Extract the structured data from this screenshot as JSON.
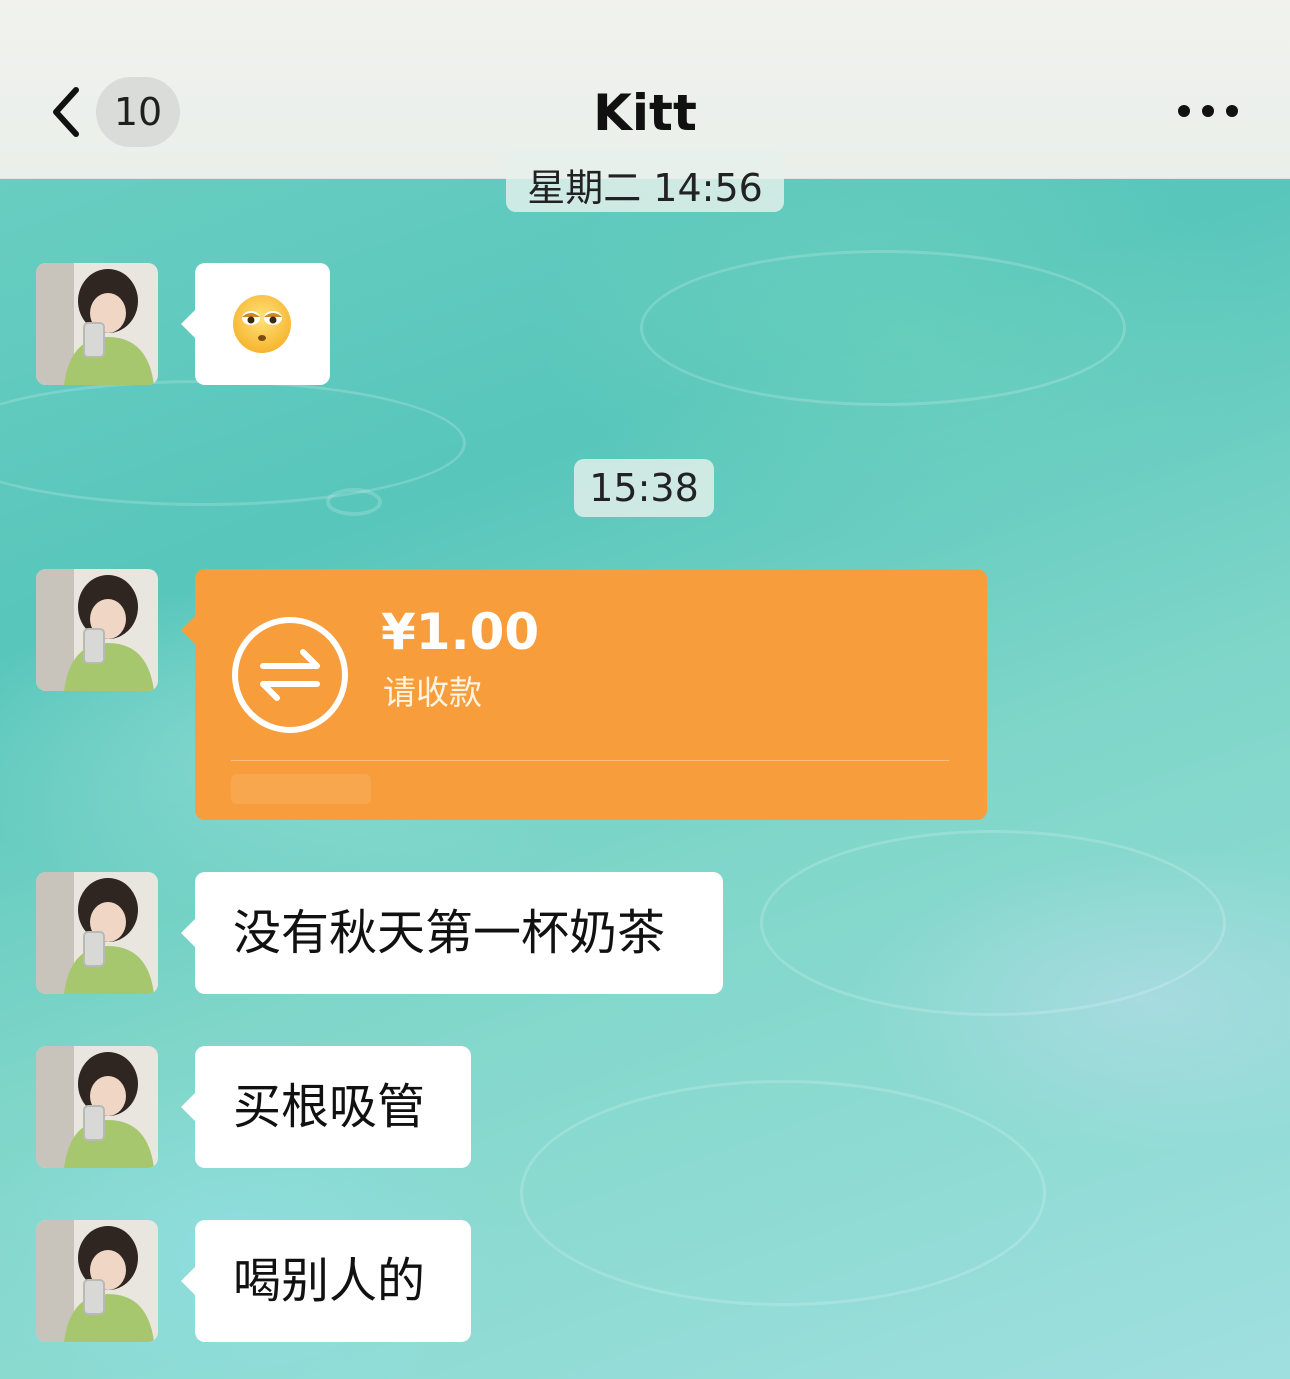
{
  "header": {
    "back_icon": "chevron-left-icon",
    "unread_count": "10",
    "title": "Kitt",
    "more_icon": "more-horizontal-icon"
  },
  "messages": {
    "time_top": "星期二 14:56",
    "emoji_icon": "rolling-eyes-emoji-icon",
    "time_main": "15:38",
    "transfer": {
      "icon": "transfer-arrows-icon",
      "amount": "¥1.00",
      "status": "请收款",
      "color": "#f89d3b"
    },
    "texts": [
      "没有秋天第一杯奶茶",
      "买根吸管",
      "喝别人的"
    ]
  }
}
